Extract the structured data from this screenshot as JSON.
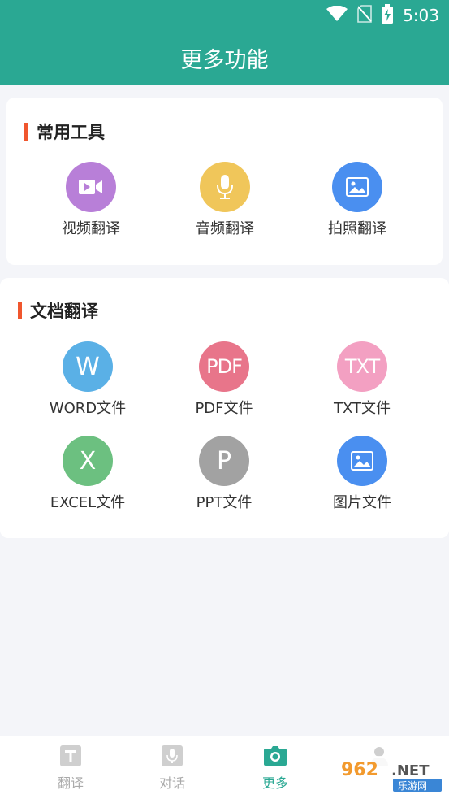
{
  "status_bar": {
    "time": "5:03",
    "icons": [
      "wifi-icon",
      "no-sim-icon",
      "battery-charging-icon"
    ]
  },
  "header": {
    "title": "更多功能"
  },
  "common_tools": {
    "title": "常用工具",
    "items": [
      {
        "label": "视频翻译",
        "icon": "video-icon",
        "color": "#b87fd8"
      },
      {
        "label": "音频翻译",
        "icon": "microphone-icon",
        "color": "#f0c65a"
      },
      {
        "label": "拍照翻译",
        "icon": "image-icon",
        "color": "#4a8ff0"
      }
    ]
  },
  "doc_translate": {
    "title": "文档翻译",
    "items": [
      {
        "glyph": "W",
        "label": "WORD文件",
        "color": "#5ab0e6"
      },
      {
        "glyph": "PDF",
        "label": "PDF文件",
        "color": "#e8758a"
      },
      {
        "glyph": "TXT",
        "label": "TXT文件",
        "color": "#f3a0c2"
      },
      {
        "glyph": "X",
        "label": "EXCEL文件",
        "color": "#6cc080"
      },
      {
        "glyph": "P",
        "label": "PPT文件",
        "color": "#a2a2a2"
      },
      {
        "label": "图片文件",
        "icon": "image-icon",
        "color": "#4a8ff0"
      }
    ]
  },
  "tabbar": {
    "tabs": [
      {
        "label": "翻译",
        "icon": "text-t-icon",
        "active": false
      },
      {
        "label": "对话",
        "icon": "microphone-icon",
        "active": false
      },
      {
        "label": "更多",
        "icon": "camera-icon",
        "active": true
      },
      {
        "label": "",
        "icon": "person-icon",
        "active": false
      }
    ],
    "active_color": "#2aa893"
  },
  "watermark": {
    "text_top": "962.NET",
    "text_bottom": "乐游网"
  }
}
